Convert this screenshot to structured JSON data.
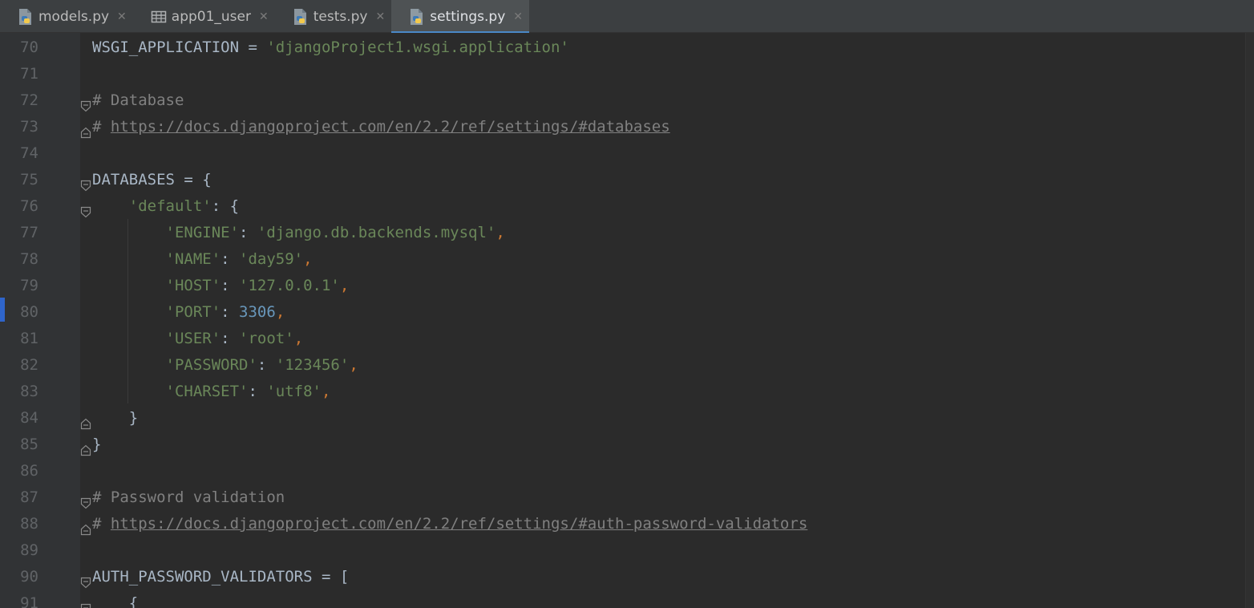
{
  "tabs": [
    {
      "label": "models.py",
      "icon": "python-file-icon",
      "active": false
    },
    {
      "label": "app01_user",
      "icon": "table-icon",
      "active": false
    },
    {
      "label": "tests.py",
      "icon": "python-file-icon",
      "active": false
    },
    {
      "label": "settings.py",
      "icon": "python-file-icon",
      "active": true
    }
  ],
  "tab_close_glyph": "✕",
  "colors": {
    "string": "#6a8759",
    "number": "#6897bb",
    "comment": "#808080",
    "keyword_punct": "#cc7832",
    "text": "#a9b7c6",
    "active_tab_underline": "#4a88c7"
  },
  "editor": {
    "lines": [
      {
        "num": "70",
        "fold": "",
        "segs": [
          [
            "p",
            "WSGI_APPLICATION = "
          ],
          [
            "s",
            "'djangoProject1.wsgi.application'"
          ]
        ]
      },
      {
        "num": "71",
        "fold": "",
        "segs": []
      },
      {
        "num": "72",
        "fold": "open",
        "segs": [
          [
            "c",
            "# Database"
          ]
        ]
      },
      {
        "num": "73",
        "fold": "close",
        "segs": [
          [
            "c",
            "# "
          ],
          [
            "l",
            "https://docs.djangoproject.com/en/2.2/ref/settings/#databases"
          ]
        ]
      },
      {
        "num": "74",
        "fold": "",
        "segs": []
      },
      {
        "num": "75",
        "fold": "open",
        "segs": [
          [
            "p",
            "DATABASES = {"
          ]
        ]
      },
      {
        "num": "76",
        "fold": "open",
        "segs": [
          [
            "p",
            "    "
          ],
          [
            "s",
            "'default'"
          ],
          [
            "p",
            ": {"
          ]
        ]
      },
      {
        "num": "77",
        "fold": "",
        "segs": [
          [
            "p",
            "        "
          ],
          [
            "s",
            "'ENGINE'"
          ],
          [
            "p",
            ": "
          ],
          [
            "s",
            "'django.db.backends.mysql'"
          ],
          [
            "k",
            ","
          ]
        ]
      },
      {
        "num": "78",
        "fold": "",
        "segs": [
          [
            "p",
            "        "
          ],
          [
            "s",
            "'NAME'"
          ],
          [
            "p",
            ": "
          ],
          [
            "s",
            "'day59'"
          ],
          [
            "k",
            ","
          ]
        ]
      },
      {
        "num": "79",
        "fold": "",
        "segs": [
          [
            "p",
            "        "
          ],
          [
            "s",
            "'HOST'"
          ],
          [
            "p",
            ": "
          ],
          [
            "s",
            "'127.0.0.1'"
          ],
          [
            "k",
            ","
          ]
        ]
      },
      {
        "num": "80",
        "fold": "",
        "segs": [
          [
            "p",
            "        "
          ],
          [
            "s",
            "'PORT'"
          ],
          [
            "p",
            ": "
          ],
          [
            "n",
            "3306"
          ],
          [
            "k",
            ","
          ]
        ]
      },
      {
        "num": "81",
        "fold": "",
        "segs": [
          [
            "p",
            "        "
          ],
          [
            "s",
            "'USER'"
          ],
          [
            "p",
            ": "
          ],
          [
            "s",
            "'root'"
          ],
          [
            "k",
            ","
          ]
        ]
      },
      {
        "num": "82",
        "fold": "",
        "segs": [
          [
            "p",
            "        "
          ],
          [
            "s",
            "'PASSWORD'"
          ],
          [
            "p",
            ": "
          ],
          [
            "s",
            "'123456'"
          ],
          [
            "k",
            ","
          ]
        ]
      },
      {
        "num": "83",
        "fold": "",
        "segs": [
          [
            "p",
            "        "
          ],
          [
            "s",
            "'CHARSET'"
          ],
          [
            "p",
            ": "
          ],
          [
            "s",
            "'utf8'"
          ],
          [
            "k",
            ","
          ]
        ]
      },
      {
        "num": "84",
        "fold": "close",
        "segs": [
          [
            "p",
            "    }"
          ]
        ]
      },
      {
        "num": "85",
        "fold": "close",
        "segs": [
          [
            "p",
            "}"
          ]
        ]
      },
      {
        "num": "86",
        "fold": "",
        "segs": []
      },
      {
        "num": "87",
        "fold": "open",
        "segs": [
          [
            "c",
            "# Password validation"
          ]
        ]
      },
      {
        "num": "88",
        "fold": "close",
        "segs": [
          [
            "c",
            "# "
          ],
          [
            "l",
            "https://docs.djangoproject.com/en/2.2/ref/settings/#auth-password-validators"
          ]
        ]
      },
      {
        "num": "89",
        "fold": "",
        "segs": []
      },
      {
        "num": "90",
        "fold": "open",
        "segs": [
          [
            "p",
            "AUTH_PASSWORD_VALIDATORS = ["
          ]
        ]
      },
      {
        "num": "91",
        "fold": "open",
        "segs": [
          [
            "p",
            "    {"
          ]
        ]
      }
    ]
  }
}
